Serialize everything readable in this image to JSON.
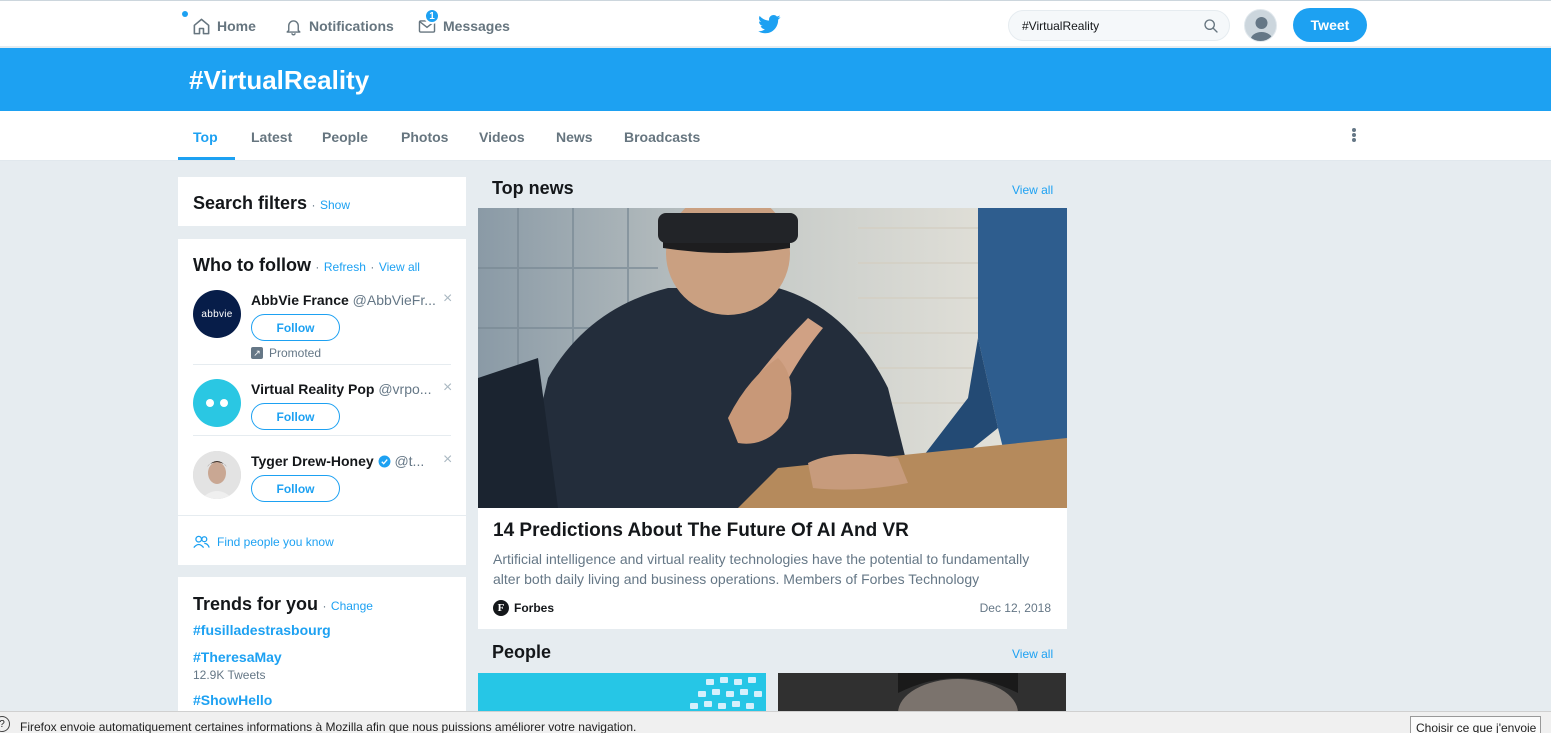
{
  "topbar": {
    "nav": [
      {
        "label": "Home",
        "icon": "home-icon"
      },
      {
        "label": "Notifications",
        "icon": "bell-icon"
      },
      {
        "label": "Messages",
        "icon": "envelope-icon"
      }
    ],
    "messages_badge": "1",
    "search_value": "#VirtualReality",
    "tweet_label": "Tweet"
  },
  "hero": {
    "title": "#VirtualReality"
  },
  "tabs": [
    "Top",
    "Latest",
    "People",
    "Photos",
    "Videos",
    "News",
    "Broadcasts"
  ],
  "active_tab": "Top",
  "search_filters": {
    "title": "Search filters",
    "show_label": "Show"
  },
  "who_to_follow": {
    "title": "Who to follow",
    "refresh_label": "Refresh",
    "view_all_label": "View all",
    "accounts": [
      {
        "name": "AbbVie France",
        "handle": "@AbbVieFr...",
        "follow_label": "Follow",
        "promoted_label": "Promoted",
        "avatar_text": "abbvie"
      },
      {
        "name": "Virtual Reality Pop",
        "handle": "@vrpo...",
        "follow_label": "Follow"
      },
      {
        "name": "Tyger Drew-Honey",
        "handle": "@t...",
        "follow_label": "Follow",
        "verified": true
      }
    ],
    "find_people_label": "Find people you know"
  },
  "trends": {
    "title": "Trends for you",
    "change_label": "Change",
    "items": [
      {
        "name": "#fusilladestrasbourg",
        "count": ""
      },
      {
        "name": "#TheresaMay",
        "count": "12.9K Tweets"
      },
      {
        "name": "#ShowHello",
        "count": ""
      }
    ]
  },
  "top_news": {
    "title": "Top news",
    "view_all_label": "View all",
    "article": {
      "headline": "14 Predictions About The Future Of AI And VR",
      "description": "Artificial intelligence and virtual reality technologies have the potential to fundamentally alter both daily living and business operations. Members of Forbes Technology Council...",
      "source": "Forbes",
      "source_logo": "F",
      "date": "Dec 12, 2018"
    }
  },
  "people": {
    "title": "People",
    "view_all_label": "View all"
  },
  "firefox_bar": {
    "info_icon": "?",
    "message": "Firefox envoie automatiquement certaines informations à Mozilla afin que nous puissions améliorer votre navigation.",
    "button_label": "Choisir ce que j'envoie"
  },
  "colors": {
    "accent": "#1da1f2",
    "background": "#e6ecf0",
    "muted": "#657786"
  }
}
